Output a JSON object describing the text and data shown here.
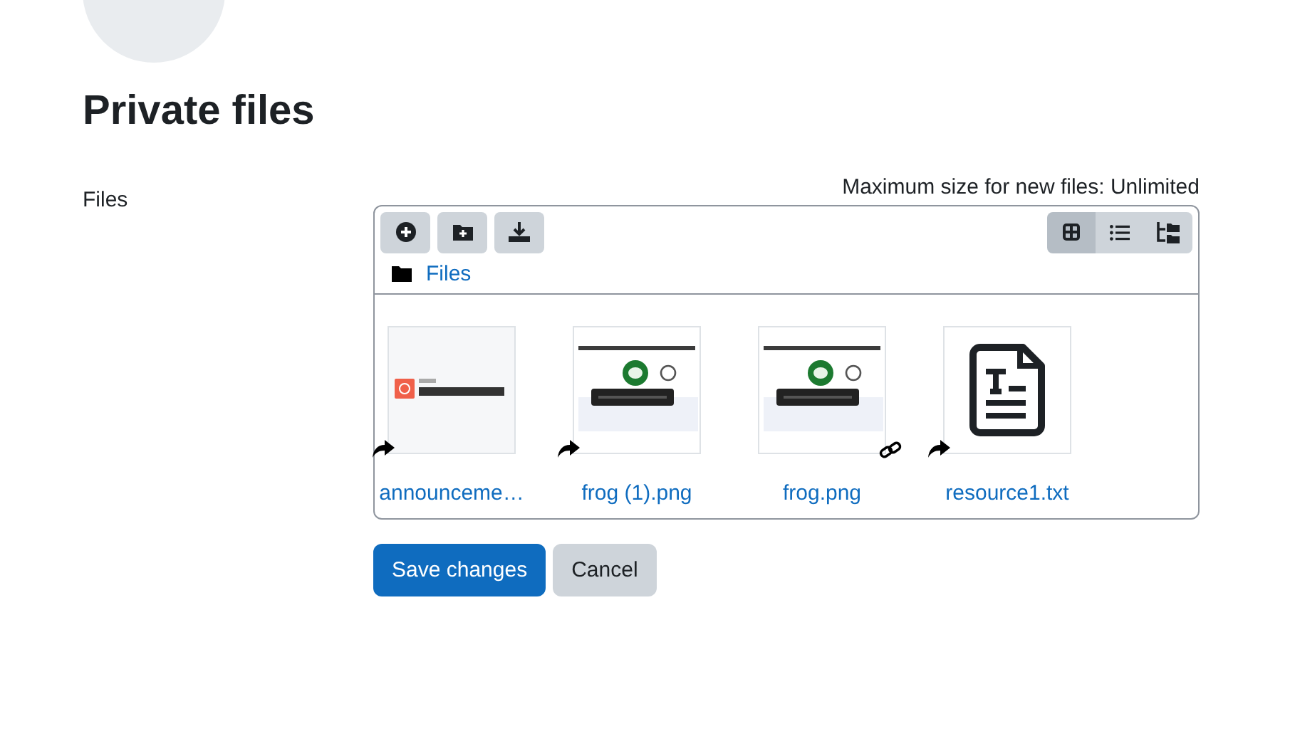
{
  "page_title": "Private files",
  "form": {
    "label": "Files",
    "max_size": "Maximum size for new files: Unlimited",
    "toolbar": {
      "actions": [
        {
          "kind": "add"
        },
        {
          "kind": "new-folder"
        },
        {
          "kind": "download"
        }
      ],
      "views": [
        {
          "kind": "icons",
          "selected": true
        },
        {
          "kind": "list",
          "selected": false
        },
        {
          "kind": "tree",
          "selected": false
        }
      ]
    },
    "path": "Files",
    "files": [
      {
        "name": "announceme…",
        "kind": "picture",
        "alias": true,
        "linked": false
      },
      {
        "name": "frog (1).png",
        "kind": "picture",
        "alias": true,
        "linked": false
      },
      {
        "name": "frog.png",
        "kind": "picture",
        "alias": false,
        "linked": true
      },
      {
        "name": "resource1.txt",
        "kind": "text",
        "alias": true,
        "linked": false
      }
    ]
  },
  "buttons": [
    {
      "label": "Save changes",
      "kind": "primary"
    },
    {
      "label": "Cancel",
      "kind": "secondary"
    }
  ]
}
